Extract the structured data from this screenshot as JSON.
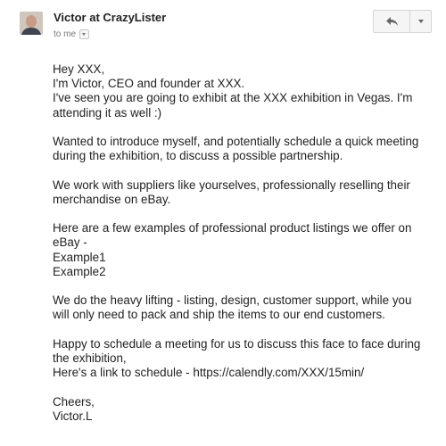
{
  "header": {
    "sender": "Victor at CrazyLister",
    "recipient": "to me"
  },
  "body": {
    "greeting": "Hey XXX,",
    "intro_line1": "I'm Victor, CEO and founder at XXX.",
    "intro_line2": "I've seen you are going to exhibit at the XXX exhibition in Vegas. I'm",
    "intro_line3": "attending it as well :)",
    "p2_line1": "Wanted to introduce myself, and potentially schedule a quick meeting",
    "p2_line2": "during the exhibition, to discuss a possible partnership.",
    "p3_line1": "We work with suppliers like yourselves, professionally reselling their",
    "p3_line2": "merchandise on eBay.",
    "p4_line1": "Here are a few examples of professional product listings we offer on",
    "p4_line2": "eBay -",
    "example1": "Example1",
    "example2": "Example2",
    "p5_line1": "We do the heavy lifting - listing, design, customer support, while you",
    "p5_line2": "will only need to pack and ship the items to our end customers.",
    "p6_line1": "Happy to schedule a meeting for us to discuss this face to face during",
    "p6_line2": "the exhibition,",
    "p6_line3": "Here's a link to schedule - https://calendly.com/XXX/15min/",
    "signoff": "Cheers,",
    "signature": "Victor.L"
  },
  "icons": {
    "reply": "reply-arrow-icon",
    "more": "chevron-down-icon",
    "recipient_details": "chevron-down-icon"
  },
  "colors": {
    "sender_name": "#222222",
    "muted_text": "#777777",
    "button_background": "#f5f5f5"
  }
}
